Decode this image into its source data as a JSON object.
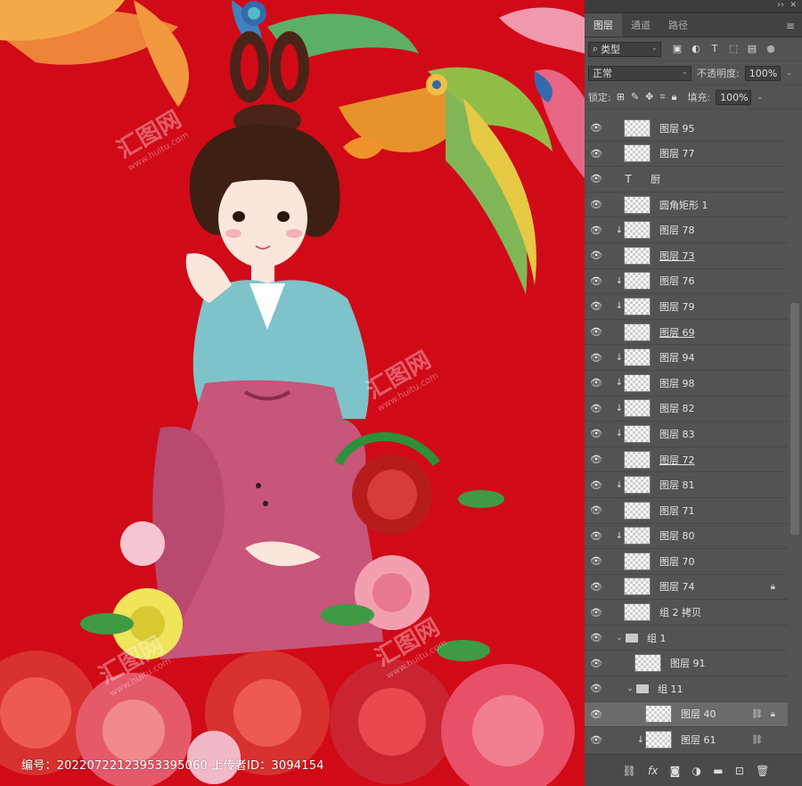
{
  "panel": {
    "tabs": [
      "图层",
      "通道",
      "路径"
    ],
    "filter_kind": "类型",
    "blend_mode": "正常",
    "opacity_label": "不透明度:",
    "opacity_value": "100%",
    "lock_label": "锁定:",
    "fill_label": "填充:",
    "fill_value": "100%",
    "layers": [
      {
        "name": "图层 95",
        "clip": false,
        "indent": 0
      },
      {
        "name": "图层 77",
        "clip": false,
        "indent": 0
      },
      {
        "name": "厨",
        "clip": false,
        "indent": 0,
        "type": "text"
      },
      {
        "name": "圆角矩形 1",
        "clip": false,
        "indent": 0
      },
      {
        "name": "图层 78",
        "clip": true,
        "indent": 0
      },
      {
        "name": "图层 73",
        "clip": false,
        "indent": 0,
        "underline": true
      },
      {
        "name": "图层 76",
        "clip": true,
        "indent": 0
      },
      {
        "name": "图层 79",
        "clip": true,
        "indent": 0
      },
      {
        "name": "图层 69",
        "clip": false,
        "indent": 0,
        "underline": true
      },
      {
        "name": "图层 94",
        "clip": true,
        "indent": 0
      },
      {
        "name": "图层 98",
        "clip": true,
        "indent": 0
      },
      {
        "name": "图层 82",
        "clip": true,
        "indent": 0
      },
      {
        "name": "图层 83",
        "clip": true,
        "indent": 0
      },
      {
        "name": "图层 72",
        "clip": false,
        "indent": 0,
        "underline": true
      },
      {
        "name": "图层 81",
        "clip": true,
        "indent": 0
      },
      {
        "name": "图层 71",
        "clip": false,
        "indent": 0
      },
      {
        "name": "图层 80",
        "clip": true,
        "indent": 0
      },
      {
        "name": "图层 70",
        "clip": false,
        "indent": 0
      },
      {
        "name": "图层 74",
        "clip": false,
        "indent": 0,
        "locked": true
      },
      {
        "name": "组 2 拷贝",
        "clip": false,
        "indent": 0
      },
      {
        "name": "组 1",
        "clip": false,
        "indent": 0,
        "type": "group"
      },
      {
        "name": "图层 91",
        "clip": false,
        "indent": 1
      },
      {
        "name": "组 11",
        "clip": false,
        "indent": 1,
        "type": "group"
      },
      {
        "name": "图层 40",
        "clip": false,
        "indent": 2,
        "selected": true,
        "locked": true,
        "linked": true
      },
      {
        "name": "图层 61",
        "clip": true,
        "indent": 2,
        "linked": true
      }
    ]
  },
  "footer": {
    "caption": "编号：20220722123953395060 上传者ID：3094154"
  },
  "watermark": {
    "text": "汇图网",
    "sub": "www.huitu.com"
  },
  "colors": {
    "background": "#d10a18",
    "panel": "#535353"
  }
}
